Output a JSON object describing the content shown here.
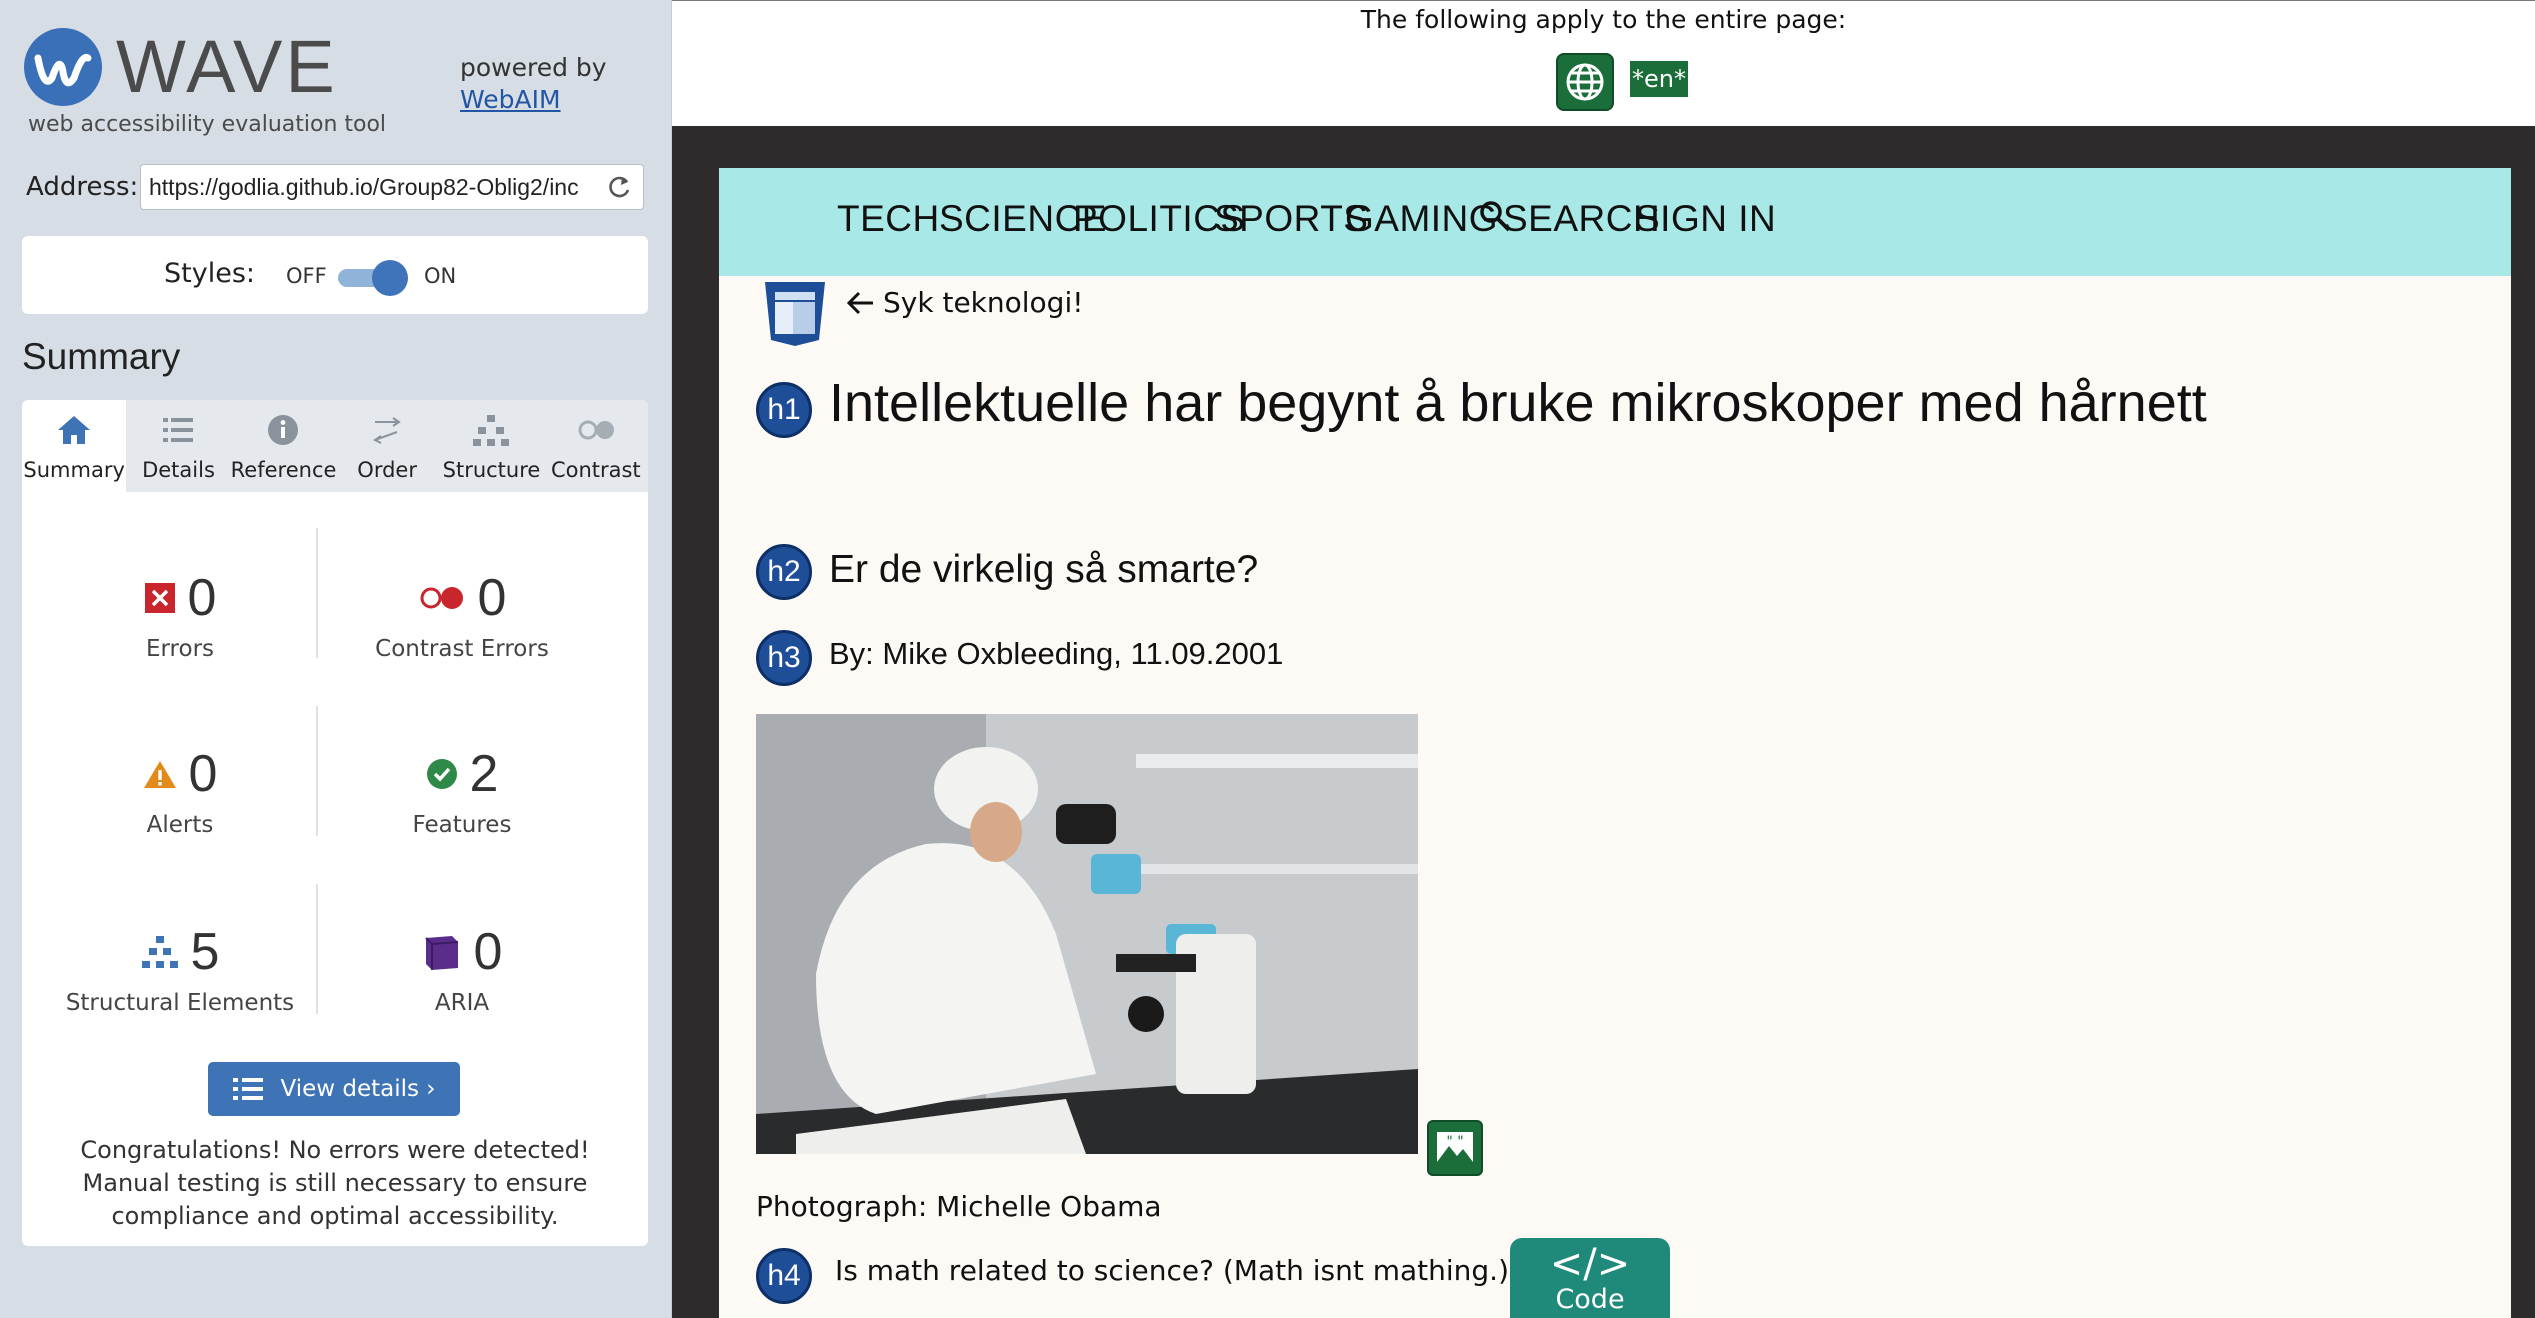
{
  "wave": {
    "logo_text": "WAVE",
    "tagline": "web accessibility evaluation tool",
    "powered_by": "powered by",
    "powered_link": "WebAIM",
    "address_label": "Address:",
    "address_value": "https://godlia.github.io/Group82-Oblig2/inc",
    "styles_label": "Styles:",
    "styles_off": "OFF",
    "styles_on": "ON",
    "styles_state": "on",
    "summary_heading": "Summary",
    "tabs": [
      {
        "label": "Summary",
        "icon": "home-icon",
        "active": true
      },
      {
        "label": "Details",
        "icon": "list-icon",
        "active": false
      },
      {
        "label": "Reference",
        "icon": "info-icon",
        "active": false
      },
      {
        "label": "Order",
        "icon": "order-icon",
        "active": false
      },
      {
        "label": "Structure",
        "icon": "structure-icon",
        "active": false
      },
      {
        "label": "Contrast",
        "icon": "contrast-icon",
        "active": false
      }
    ],
    "stats": {
      "errors": {
        "count": "0",
        "label": "Errors"
      },
      "contrast_errors": {
        "count": "0",
        "label": "Contrast Errors"
      },
      "alerts": {
        "count": "0",
        "label": "Alerts"
      },
      "features": {
        "count": "2",
        "label": "Features"
      },
      "structural": {
        "count": "5",
        "label": "Structural Elements"
      },
      "aria": {
        "count": "0",
        "label": "ARIA"
      }
    },
    "view_details_label": "View details ›",
    "congrats": "Congratulations! No errors were detected! Manual testing is still necessary to ensure compliance and optimal accessibility."
  },
  "page_info": {
    "apply_text": "The following apply to the entire page:",
    "lang_badge": "*en*"
  },
  "site": {
    "nav": [
      "TECH",
      "SCIENCE",
      "POLITICS",
      "SPORTS",
      "GAMING",
      "SEARCH",
      "SIGN IN"
    ],
    "back_link": "Syk teknologi!",
    "h1_badge": "h1",
    "h1": "Intellektuelle har begynt å bruke mikroskoper med hårnett",
    "h2_badge": "h2",
    "h2": "Er de virkelig så smarte?",
    "h3_badge": "h3",
    "h3": "By: Mike Oxbleeding, 11.09.2001",
    "caption": "Photograph: Michelle Obama",
    "h4_badge": "h4",
    "h4": "Is math related to science? (Math isnt mathing.)",
    "code_label": "Code",
    "code_symbol": "</>"
  },
  "colors": {
    "wave_panel": "#d6dde4",
    "wave_blue": "#3e73b5",
    "nav_bg": "#a8e8e6",
    "frame_bg": "#2f2a2b",
    "feature_green": "#1b6e3a",
    "heading_badge": "#1f4e98"
  }
}
